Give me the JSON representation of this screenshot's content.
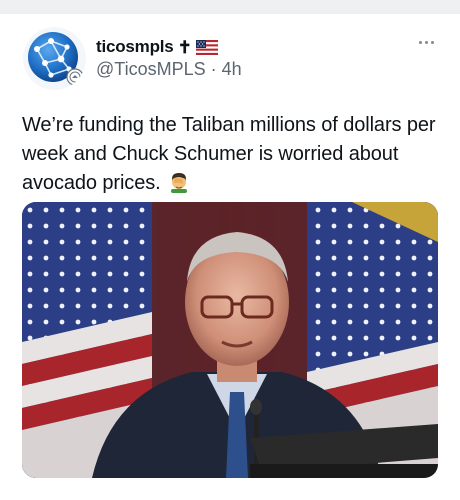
{
  "tweet": {
    "display_name": "ticosmpls",
    "name_cross": "✝",
    "handle": "@TicosMPLS",
    "separator": "·",
    "time": "4h",
    "text": "We’re funding the Taliban millions of dollars per week and Chuck Schumer is worried about avocado prices.",
    "text_emoji": "facepalm-man-emoji",
    "name_emoji": "us-flag-emoji"
  },
  "icons": {
    "avatar": "network-globe-logo",
    "more": "more-dots-icon"
  },
  "colors": {
    "text_primary": "#0f1419",
    "text_secondary": "#5b6670",
    "avatar_blue": "#1f6fc4",
    "flag_red": "#b8262e",
    "flag_navy": "#1a2a5c"
  }
}
